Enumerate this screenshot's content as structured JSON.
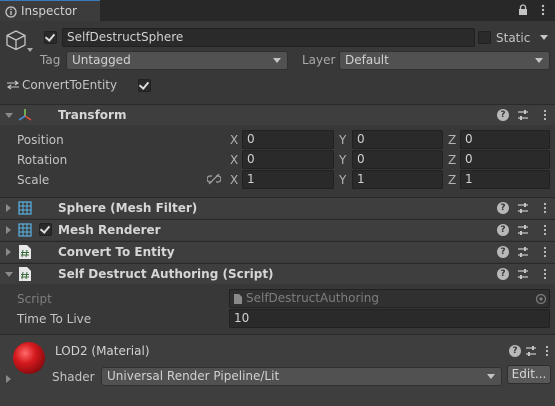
{
  "tab": {
    "title": "Inspector"
  },
  "gameobject": {
    "name": "SelfDestructSphere",
    "active": true,
    "static_label": "Static",
    "tag_label": "Tag",
    "tag_value": "Untagged",
    "layer_label": "Layer",
    "layer_value": "Default",
    "convert_label": "ConvertToEntity",
    "convert_checked": true
  },
  "transform": {
    "title": "Transform",
    "rows": [
      {
        "label": "Position",
        "x": "0",
        "y": "0",
        "z": "0"
      },
      {
        "label": "Rotation",
        "x": "0",
        "y": "0",
        "z": "0"
      },
      {
        "label": "Scale",
        "x": "1",
        "y": "1",
        "z": "1"
      }
    ],
    "axis": {
      "x": "X",
      "y": "Y",
      "z": "Z"
    }
  },
  "components": {
    "mesh_filter": "Sphere (Mesh Filter)",
    "mesh_renderer": "Mesh Renderer",
    "convert_to_entity": "Convert To Entity",
    "self_destruct": "Self Destruct Authoring (Script)"
  },
  "script_section": {
    "script_label": "Script",
    "script_value": "SelfDestructAuthoring",
    "ttl_label": "Time To Live",
    "ttl_value": "10"
  },
  "material": {
    "name": "LOD2 (Material)",
    "shader_label": "Shader",
    "shader_value": "Universal Render Pipeline/Lit",
    "edit_label": "Edit..."
  },
  "icons": {
    "inspector": "info-icon",
    "lock": "lock-icon",
    "menu": "kebab-menu-icon",
    "cube": "gameobject-cube-icon",
    "transform": "transform-axes-icon",
    "mesh": "mesh-grid-icon",
    "script": "script-hash-icon",
    "help": "help-icon",
    "presets": "presets-sliders-icon",
    "link": "constrain-proportions-icon"
  },
  "colors": {
    "background": "#383838",
    "header": "#3e3e3e",
    "field": "#2a2a2a",
    "tab_accent": "#3a79bb",
    "material_ball": "#c8151b"
  }
}
